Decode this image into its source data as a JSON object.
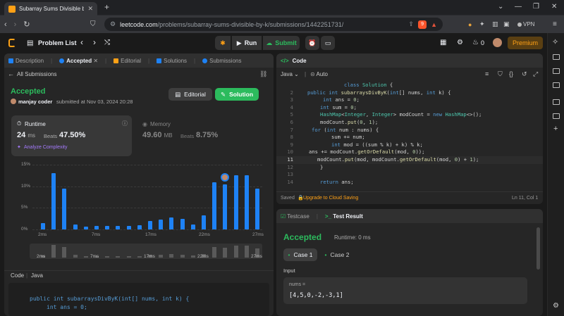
{
  "browser": {
    "tab_title": "Subarray Sums Divisible by K -",
    "url_host": "leetcode.com",
    "url_path": "/problems/subarray-sums-divisible-by-k/submissions/1442251731/",
    "shield_badge": "9",
    "vpn_label": "VPN"
  },
  "nav": {
    "problem_list": "Problem List",
    "run": "Run",
    "submit": "Submit",
    "streak": "0",
    "premium": "Premium"
  },
  "left_tabs": [
    {
      "label": "Description"
    },
    {
      "label": "Accepted"
    },
    {
      "label": "Editorial"
    },
    {
      "label": "Solutions"
    },
    {
      "label": "Submissions"
    }
  ],
  "submission": {
    "back_label": "All Submissions",
    "status": "Accepted",
    "user": "manjay coder",
    "submitted_at": "submitted at Nov 03, 2024 20:28",
    "editorial_btn": "Editorial",
    "solution_btn": "Solution",
    "runtime_label": "Runtime",
    "runtime_value": "24",
    "runtime_unit": "ms",
    "beats_label": "Beats",
    "runtime_beats": "47.50%",
    "analyze": "Analyze Complexity",
    "memory_label": "Memory",
    "memory_value": "49.60",
    "memory_unit": "MB",
    "memory_beats": "8.75%",
    "code_label": "Code",
    "lang_label": "Java",
    "preview_line1": "public int subarraysDivByK(int[] nums, int k) {",
    "preview_line2": "int ans = 0;"
  },
  "chart_data": {
    "type": "bar",
    "xlabels": [
      "2ms",
      "7ms",
      "17ms",
      "22ms",
      "27ms"
    ],
    "ylabels": [
      "15%",
      "10%",
      "5%",
      "0%"
    ],
    "ylim": [
      0,
      15
    ],
    "values": [
      1.5,
      13,
      9.5,
      1.2,
      0.6,
      0.8,
      0.8,
      0.8,
      0.8,
      0.9,
      2,
      2.3,
      2.7,
      2.5,
      1.2,
      3.3,
      11,
      10.5,
      12.5,
      12.5,
      9.5
    ],
    "mini_values": [
      0.5,
      3,
      2.5,
      0.6,
      0.4,
      0.4,
      0.4,
      0.4,
      0.4,
      0.4,
      0.6,
      0.7,
      0.8,
      0.7,
      0.5,
      0.9,
      2.5,
      2.4,
      2.8,
      2.8,
      2.2
    ],
    "mini_labels": [
      "2ms",
      "7ms",
      "17ms",
      "22ms",
      "27ms"
    ],
    "highlight_index": 17
  },
  "code_panel": {
    "title": "Code",
    "lang": "Java",
    "mode": "Auto",
    "saved": "Saved",
    "upgrade": "Upgrade to Cloud Saving",
    "cursor": "Ln 11, Col 1",
    "lines": [
      {
        "no": "",
        "indent": 96,
        "parts": [
          [
            "kw",
            "class "
          ],
          [
            "ty",
            "Solution "
          ],
          [
            "cm",
            "{"
          ]
        ]
      },
      {
        "no": "2",
        "indent": 44,
        "parts": [
          [
            "kw",
            "public int "
          ],
          [
            "fn",
            "subarraysDivByK"
          ],
          [
            "cm",
            "("
          ],
          [
            "kw",
            "int"
          ],
          [
            "cm",
            "[] nums, "
          ],
          [
            "kw",
            "int "
          ],
          [
            "cm",
            "k) {"
          ]
        ]
      },
      {
        "no": "3",
        "indent": 66,
        "parts": [
          [
            "kw",
            "int "
          ],
          [
            "cm",
            "ans = "
          ],
          [
            "nm",
            "0"
          ],
          [
            "cm",
            ";"
          ]
        ]
      },
      {
        "no": "4",
        "indent": 62,
        "parts": [
          [
            "kw",
            "int "
          ],
          [
            "cm",
            "sum = "
          ],
          [
            "nm",
            "0"
          ],
          [
            "cm",
            ";"
          ]
        ]
      },
      {
        "no": "5",
        "indent": 62,
        "parts": [
          [
            "ty",
            "HashMap"
          ],
          [
            "cm",
            "<"
          ],
          [
            "ty",
            "Integer"
          ],
          [
            "cm",
            ", "
          ],
          [
            "ty",
            "Integer"
          ],
          [
            "cm",
            "> modCount = "
          ],
          [
            "kw",
            "new "
          ],
          [
            "ty",
            "HashMap"
          ],
          [
            "cm",
            "<>();"
          ]
        ]
      },
      {
        "no": "6",
        "indent": 62,
        "parts": [
          [
            "cm",
            "modCount."
          ],
          [
            "fn",
            "put"
          ],
          [
            "cm",
            "("
          ],
          [
            "nm",
            "0"
          ],
          [
            "cm",
            ", "
          ],
          [
            "nm",
            "1"
          ],
          [
            "cm",
            ");"
          ]
        ]
      },
      {
        "no": "7",
        "indent": 50,
        "parts": [
          [
            "kw",
            "for "
          ],
          [
            "cm",
            "("
          ],
          [
            "kw",
            "int "
          ],
          [
            "cm",
            "num : nums) {"
          ]
        ]
      },
      {
        "no": "8",
        "indent": 78,
        "parts": [
          [
            "cm",
            "sum += num;"
          ]
        ]
      },
      {
        "no": "9",
        "indent": 78,
        "parts": [
          [
            "kw",
            "int "
          ],
          [
            "cm",
            "mod = ((sum % k) + k) % k;"
          ]
        ]
      },
      {
        "no": "10",
        "indent": 46,
        "parts": [
          [
            "cm",
            "ans += modCount."
          ],
          [
            "fn",
            "getOrDefault"
          ],
          [
            "cm",
            "(mod, "
          ],
          [
            "nm",
            "0"
          ],
          [
            "cm",
            "));"
          ]
        ]
      },
      {
        "no": "11",
        "indent": 58,
        "parts": [
          [
            "cm",
            "modCount."
          ],
          [
            "fn",
            "put"
          ],
          [
            "cm",
            "(mod, modCount."
          ],
          [
            "fn",
            "getOrDefault"
          ],
          [
            "cm",
            "(mod, "
          ],
          [
            "nm",
            "0"
          ],
          [
            "cm",
            ") + "
          ],
          [
            "nm",
            "1"
          ],
          [
            "cm",
            ");"
          ]
        ]
      },
      {
        "no": "12",
        "indent": 62,
        "parts": [
          [
            "cm",
            "}"
          ]
        ]
      },
      {
        "no": "13",
        "indent": 62,
        "parts": [
          [
            "cm",
            ""
          ]
        ]
      },
      {
        "no": "14",
        "indent": 62,
        "parts": [
          [
            "kw",
            "return "
          ],
          [
            "cm",
            "ans;"
          ]
        ]
      }
    ]
  },
  "test_panel": {
    "tab_testcase": "Testcase",
    "tab_result": "Test Result",
    "status": "Accepted",
    "runtime": "Runtime: 0 ms",
    "case1": "Case 1",
    "case2": "Case 2",
    "input_label": "Input",
    "var_label": "nums =",
    "var_value": "[4,5,0,-2,-3,1]"
  },
  "colors": {
    "green": "#2cbb5d",
    "orange": "#ffa116",
    "blue": "#1e82f5"
  }
}
